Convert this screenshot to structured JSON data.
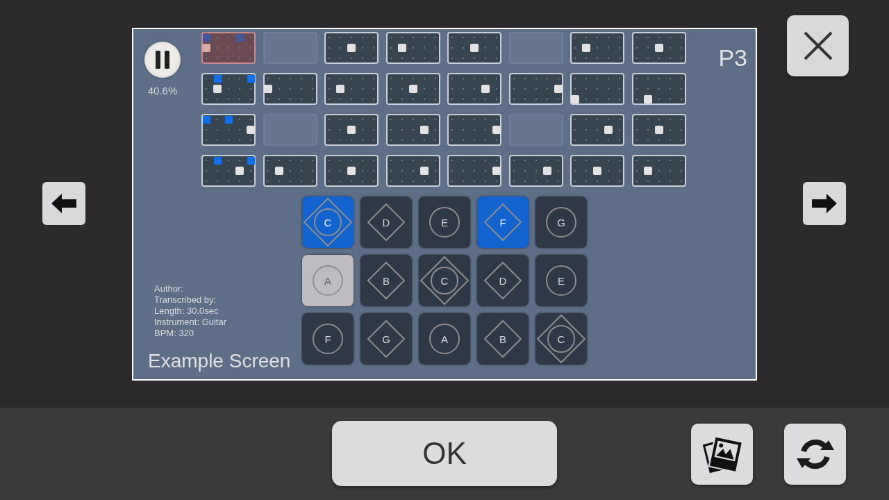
{
  "progress": "40.6%",
  "page_label": "P3",
  "tiles": [
    {
      "kind": "current",
      "marks": [
        true,
        false,
        false,
        true,
        false
      ],
      "notes": [
        [
          false,
          false,
          false,
          false,
          false
        ],
        [
          true,
          false,
          false,
          false,
          false
        ],
        [
          false,
          false,
          false,
          false,
          false
        ]
      ]
    },
    {
      "kind": "empty"
    },
    {
      "kind": "pattern",
      "marks": [
        false,
        false,
        false,
        false,
        false
      ],
      "notes": [
        [
          false,
          false,
          false,
          false,
          false
        ],
        [
          false,
          false,
          true,
          false,
          false
        ],
        [
          false,
          false,
          false,
          false,
          false
        ]
      ]
    },
    {
      "kind": "pattern",
      "marks": [
        false,
        false,
        false,
        false,
        false
      ],
      "notes": [
        [
          false,
          false,
          false,
          false,
          false
        ],
        [
          false,
          true,
          false,
          false,
          false
        ],
        [
          false,
          false,
          false,
          false,
          false
        ]
      ]
    },
    {
      "kind": "pattern",
      "marks": [
        false,
        false,
        false,
        false,
        false
      ],
      "notes": [
        [
          false,
          false,
          false,
          false,
          false
        ],
        [
          false,
          false,
          true,
          false,
          false
        ],
        [
          false,
          false,
          false,
          false,
          false
        ]
      ]
    },
    {
      "kind": "empty"
    },
    {
      "kind": "pattern",
      "marks": [
        false,
        false,
        false,
        false,
        false
      ],
      "notes": [
        [
          false,
          false,
          false,
          false,
          false
        ],
        [
          false,
          true,
          false,
          false,
          false
        ],
        [
          false,
          false,
          false,
          false,
          false
        ]
      ]
    },
    {
      "kind": "pattern",
      "marks": [
        false,
        false,
        false,
        false,
        false
      ],
      "notes": [
        [
          false,
          false,
          false,
          false,
          false
        ],
        [
          false,
          false,
          true,
          false,
          false
        ],
        [
          false,
          false,
          false,
          false,
          false
        ]
      ]
    },
    {
      "kind": "pattern",
      "marks": [
        false,
        true,
        false,
        false,
        true
      ],
      "notes": [
        [
          false,
          false,
          false,
          false,
          false
        ],
        [
          false,
          true,
          false,
          false,
          false
        ],
        [
          false,
          false,
          false,
          false,
          false
        ]
      ]
    },
    {
      "kind": "pattern",
      "marks": [
        false,
        false,
        false,
        false,
        false
      ],
      "notes": [
        [
          false,
          false,
          false,
          false,
          false
        ],
        [
          true,
          false,
          false,
          false,
          false
        ],
        [
          false,
          false,
          false,
          false,
          false
        ]
      ]
    },
    {
      "kind": "pattern",
      "marks": [
        false,
        false,
        false,
        false,
        false
      ],
      "notes": [
        [
          false,
          false,
          false,
          false,
          false
        ],
        [
          false,
          true,
          false,
          false,
          false
        ],
        [
          false,
          false,
          false,
          false,
          false
        ]
      ]
    },
    {
      "kind": "pattern",
      "marks": [
        false,
        false,
        false,
        false,
        false
      ],
      "notes": [
        [
          false,
          false,
          false,
          false,
          false
        ],
        [
          false,
          false,
          true,
          false,
          false
        ],
        [
          false,
          false,
          false,
          false,
          false
        ]
      ]
    },
    {
      "kind": "pattern",
      "marks": [
        false,
        false,
        false,
        false,
        false
      ],
      "notes": [
        [
          false,
          false,
          false,
          false,
          false
        ],
        [
          false,
          false,
          false,
          true,
          false
        ],
        [
          false,
          false,
          false,
          false,
          false
        ]
      ]
    },
    {
      "kind": "pattern",
      "marks": [
        false,
        false,
        false,
        false,
        false
      ],
      "notes": [
        [
          false,
          false,
          false,
          false,
          false
        ],
        [
          false,
          false,
          false,
          false,
          true
        ],
        [
          false,
          false,
          false,
          false,
          false
        ]
      ]
    },
    {
      "kind": "pattern",
      "marks": [
        false,
        false,
        false,
        false,
        false
      ],
      "notes": [
        [
          false,
          false,
          false,
          false,
          false
        ],
        [
          false,
          false,
          false,
          false,
          false
        ],
        [
          true,
          false,
          false,
          false,
          false
        ]
      ]
    },
    {
      "kind": "pattern",
      "marks": [
        false,
        false,
        false,
        false,
        false
      ],
      "notes": [
        [
          false,
          false,
          false,
          false,
          false
        ],
        [
          false,
          false,
          false,
          false,
          false
        ],
        [
          false,
          true,
          false,
          false,
          false
        ]
      ]
    },
    {
      "kind": "pattern",
      "marks": [
        true,
        false,
        true,
        false,
        false
      ],
      "notes": [
        [
          false,
          false,
          false,
          false,
          false
        ],
        [
          false,
          false,
          false,
          false,
          true
        ],
        [
          false,
          false,
          false,
          false,
          false
        ]
      ]
    },
    {
      "kind": "empty"
    },
    {
      "kind": "pattern",
      "marks": [
        false,
        false,
        false,
        false,
        false
      ],
      "notes": [
        [
          false,
          false,
          false,
          false,
          false
        ],
        [
          false,
          false,
          true,
          false,
          false
        ],
        [
          false,
          false,
          false,
          false,
          false
        ]
      ]
    },
    {
      "kind": "pattern",
      "marks": [
        false,
        false,
        false,
        false,
        false
      ],
      "notes": [
        [
          false,
          false,
          false,
          false,
          false
        ],
        [
          false,
          false,
          false,
          true,
          false
        ],
        [
          false,
          false,
          false,
          false,
          false
        ]
      ]
    },
    {
      "kind": "pattern",
      "marks": [
        false,
        false,
        false,
        false,
        false
      ],
      "notes": [
        [
          false,
          false,
          false,
          false,
          false
        ],
        [
          false,
          false,
          false,
          false,
          true
        ],
        [
          false,
          false,
          false,
          false,
          false
        ]
      ]
    },
    {
      "kind": "empty"
    },
    {
      "kind": "pattern",
      "marks": [
        false,
        false,
        false,
        false,
        false
      ],
      "notes": [
        [
          false,
          false,
          false,
          false,
          false
        ],
        [
          false,
          false,
          false,
          true,
          false
        ],
        [
          false,
          false,
          false,
          false,
          false
        ]
      ]
    },
    {
      "kind": "pattern",
      "marks": [
        false,
        false,
        false,
        false,
        false
      ],
      "notes": [
        [
          false,
          false,
          false,
          false,
          false
        ],
        [
          false,
          false,
          true,
          false,
          false
        ],
        [
          false,
          false,
          false,
          false,
          false
        ]
      ]
    },
    {
      "kind": "pattern",
      "marks": [
        false,
        true,
        false,
        false,
        true
      ],
      "notes": [
        [
          false,
          false,
          false,
          false,
          false
        ],
        [
          false,
          false,
          false,
          true,
          false
        ],
        [
          false,
          false,
          false,
          false,
          false
        ]
      ]
    },
    {
      "kind": "pattern",
      "marks": [
        false,
        false,
        false,
        false,
        false
      ],
      "notes": [
        [
          false,
          false,
          false,
          false,
          false
        ],
        [
          false,
          true,
          false,
          false,
          false
        ],
        [
          false,
          false,
          false,
          false,
          false
        ]
      ]
    },
    {
      "kind": "pattern",
      "marks": [
        false,
        false,
        false,
        false,
        false
      ],
      "notes": [
        [
          false,
          false,
          false,
          false,
          false
        ],
        [
          false,
          false,
          true,
          false,
          false
        ],
        [
          false,
          false,
          false,
          false,
          false
        ]
      ]
    },
    {
      "kind": "pattern",
      "marks": [
        false,
        false,
        false,
        false,
        false
      ],
      "notes": [
        [
          false,
          false,
          false,
          false,
          false
        ],
        [
          false,
          false,
          false,
          true,
          false
        ],
        [
          false,
          false,
          false,
          false,
          false
        ]
      ]
    },
    {
      "kind": "pattern",
      "marks": [
        false,
        false,
        false,
        false,
        false
      ],
      "notes": [
        [
          false,
          false,
          false,
          false,
          false
        ],
        [
          false,
          false,
          false,
          false,
          true
        ],
        [
          false,
          false,
          false,
          false,
          false
        ]
      ]
    },
    {
      "kind": "pattern",
      "marks": [
        false,
        false,
        false,
        false,
        false
      ],
      "notes": [
        [
          false,
          false,
          false,
          false,
          false
        ],
        [
          false,
          false,
          false,
          true,
          false
        ],
        [
          false,
          false,
          false,
          false,
          false
        ]
      ]
    },
    {
      "kind": "pattern",
      "marks": [
        false,
        false,
        false,
        false,
        false
      ],
      "notes": [
        [
          false,
          false,
          false,
          false,
          false
        ],
        [
          false,
          false,
          true,
          false,
          false
        ],
        [
          false,
          false,
          false,
          false,
          false
        ]
      ]
    },
    {
      "kind": "pattern",
      "marks": [
        false,
        false,
        false,
        false,
        false
      ],
      "notes": [
        [
          false,
          false,
          false,
          false,
          false
        ],
        [
          false,
          true,
          false,
          false,
          false
        ],
        [
          false,
          false,
          false,
          false,
          false
        ]
      ]
    }
  ],
  "info": [
    "Author:",
    "Transcribed by:",
    "Length: 30.0sec",
    "Instrument: Guitar",
    "BPM: 320"
  ],
  "title": "Example Screen",
  "keys": [
    {
      "label": "C",
      "kind": "both",
      "pressed": true,
      "hinted": false
    },
    {
      "label": "D",
      "kind": "diamond",
      "pressed": false,
      "hinted": false
    },
    {
      "label": "E",
      "kind": "circle",
      "pressed": false,
      "hinted": false
    },
    {
      "label": "F",
      "kind": "diamond",
      "pressed": true,
      "hinted": false
    },
    {
      "label": "G",
      "kind": "circle",
      "pressed": false,
      "hinted": false
    },
    {
      "label": "A",
      "kind": "circle",
      "pressed": false,
      "hinted": true
    },
    {
      "label": "B",
      "kind": "diamond",
      "pressed": false,
      "hinted": false
    },
    {
      "label": "C",
      "kind": "both",
      "pressed": false,
      "hinted": false
    },
    {
      "label": "D",
      "kind": "diamond",
      "pressed": false,
      "hinted": false
    },
    {
      "label": "E",
      "kind": "circle",
      "pressed": false,
      "hinted": false
    },
    {
      "label": "F",
      "kind": "circle",
      "pressed": false,
      "hinted": false
    },
    {
      "label": "G",
      "kind": "diamond",
      "pressed": false,
      "hinted": false
    },
    {
      "label": "A",
      "kind": "circle",
      "pressed": false,
      "hinted": false
    },
    {
      "label": "B",
      "kind": "diamond",
      "pressed": false,
      "hinted": false
    },
    {
      "label": "C",
      "kind": "both",
      "pressed": false,
      "hinted": false
    }
  ],
  "ok_button": "OK"
}
